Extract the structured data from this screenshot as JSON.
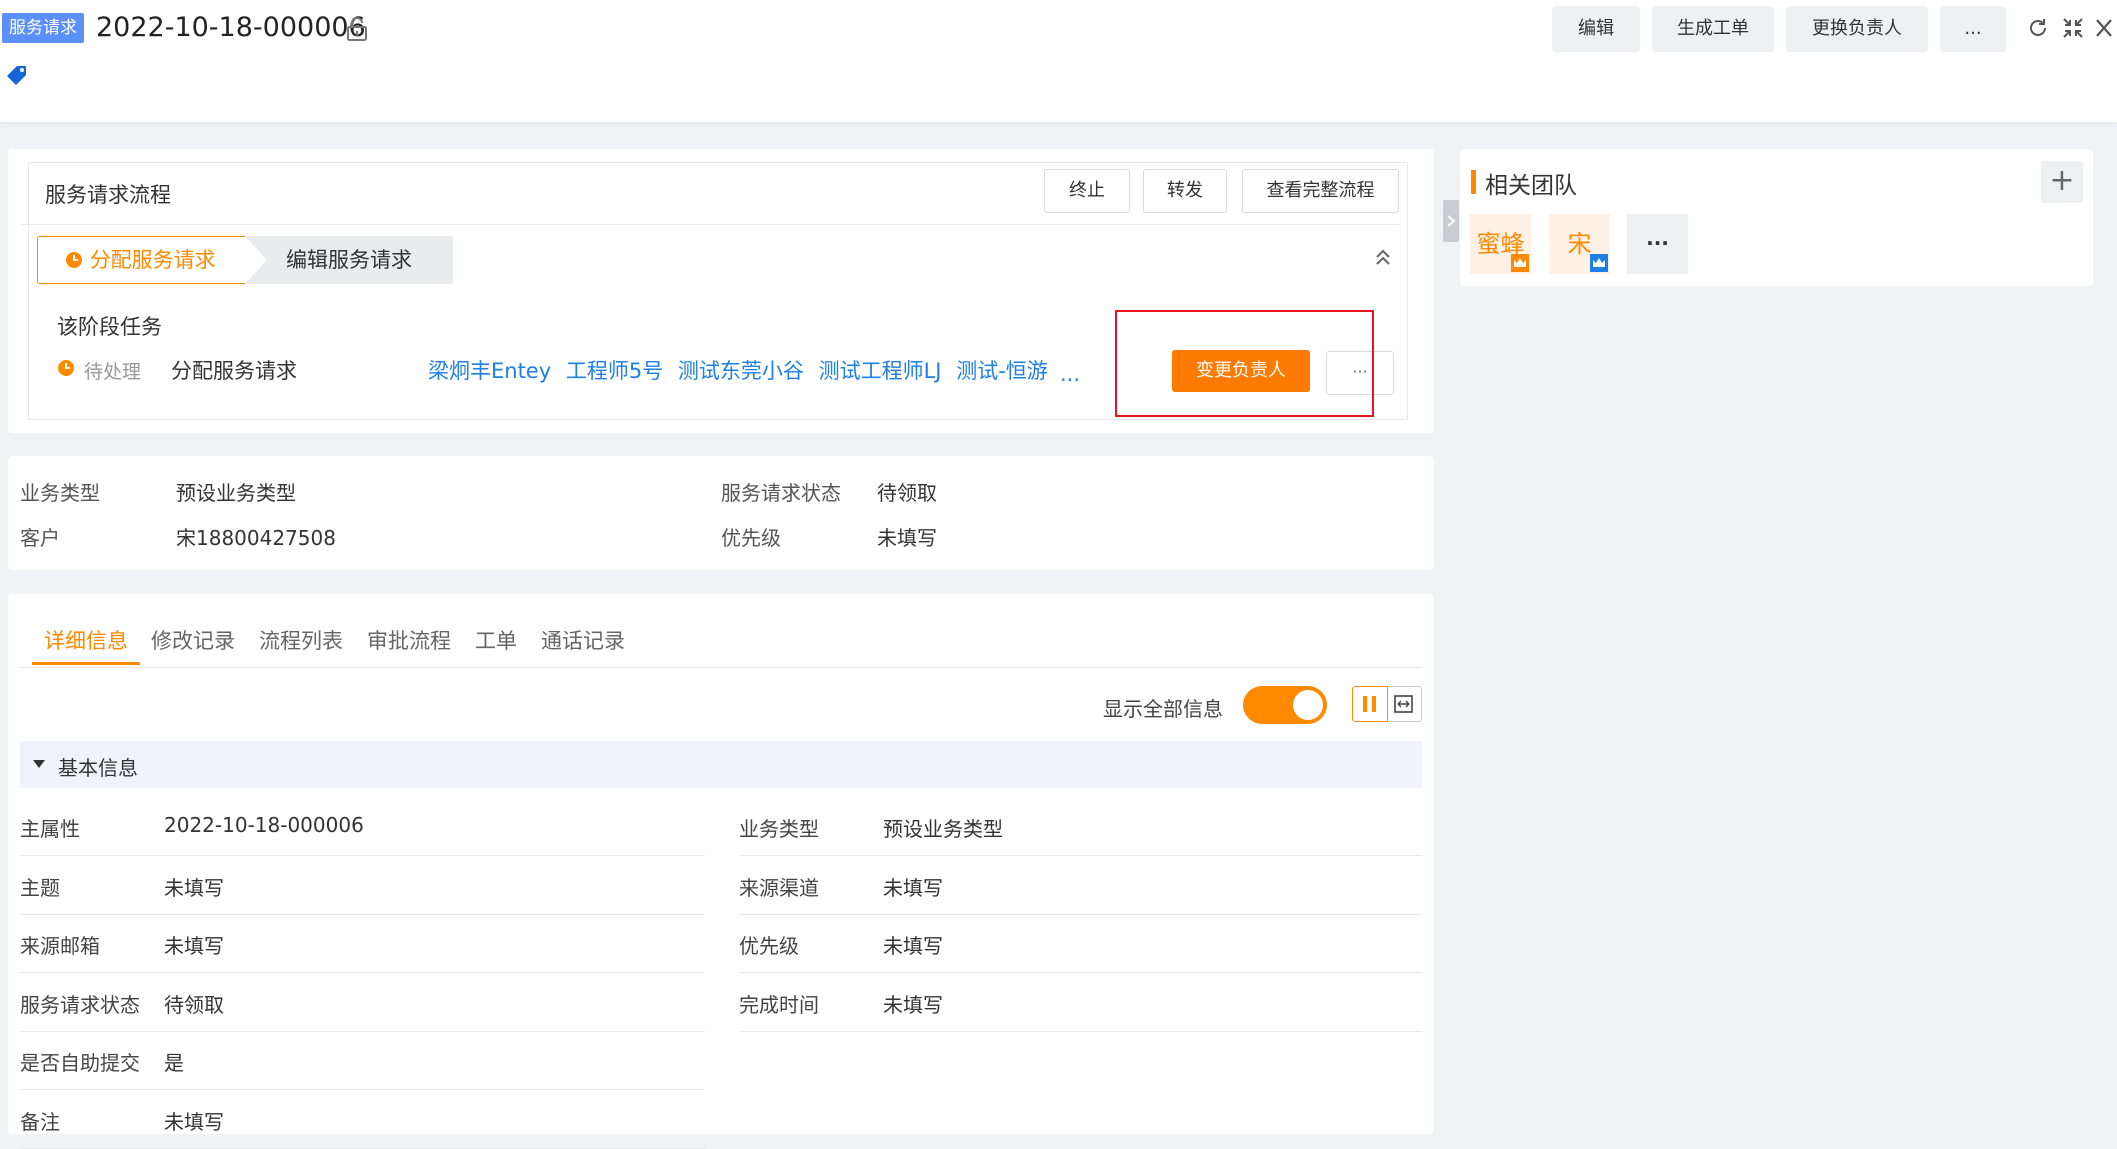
{
  "header": {
    "type_badge": "服务请求",
    "record_no": "2022-10-18-000006",
    "actions": {
      "edit": "编辑",
      "generate_workorder": "生成工单",
      "change_owner": "更换负责人",
      "more": "..."
    }
  },
  "process": {
    "title": "服务请求流程",
    "buttons": {
      "terminate": "终止",
      "forward": "转发",
      "view_full": "查看完整流程"
    },
    "stages": [
      "分配服务请求",
      "编辑服务请求"
    ],
    "task_section_title": "该阶段任务",
    "task": {
      "status": "待处理",
      "name": "分配服务请求",
      "assignees": [
        "梁炯丰Entey",
        "工程师5号",
        "测试东莞小谷",
        "测试工程师LJ",
        "测试-恒游"
      ],
      "more_assignees": "...",
      "change_owner_button": "变更负责人",
      "more_button": "···"
    }
  },
  "summary": {
    "biz_type_label": "业务类型",
    "biz_type_value": "预设业务类型",
    "status_label": "服务请求状态",
    "status_value": "待领取",
    "customer_label": "客户",
    "customer_value": "宋18800427508",
    "priority_label": "优先级",
    "priority_value": "未填写"
  },
  "tabs": [
    "详细信息",
    "修改记录",
    "流程列表",
    "审批流程",
    "工单",
    "通话记录"
  ],
  "detail": {
    "show_all_label": "显示全部信息",
    "show_all_on": true,
    "section_title": "基本信息",
    "left_fields": [
      {
        "label": "主属性",
        "value": "2022-10-18-000006",
        "empty": false
      },
      {
        "label": "主题",
        "value": "未填写",
        "empty": true
      },
      {
        "label": "来源邮箱",
        "value": "未填写",
        "empty": true
      },
      {
        "label": "服务请求状态",
        "value": "待领取",
        "empty": false
      },
      {
        "label": "是否自助提交",
        "value": "是",
        "empty": false
      },
      {
        "label": "备注",
        "value": "未填写",
        "empty": true
      }
    ],
    "right_fields": [
      {
        "label": "业务类型",
        "value": "预设业务类型",
        "empty": false
      },
      {
        "label": "来源渠道",
        "value": "未填写",
        "empty": true
      },
      {
        "label": "优先级",
        "value": "未填写",
        "empty": true
      },
      {
        "label": "完成时间",
        "value": "未填写",
        "empty": true
      }
    ]
  },
  "team": {
    "title": "相关团队",
    "add": "+",
    "members": [
      "蜜蜂",
      "宋"
    ],
    "more": "···"
  },
  "colors": {
    "accent": "#ff8a00",
    "link": "#1e7fe8",
    "badge": "#5b8ff9",
    "highlight_box": "#e8161e"
  }
}
